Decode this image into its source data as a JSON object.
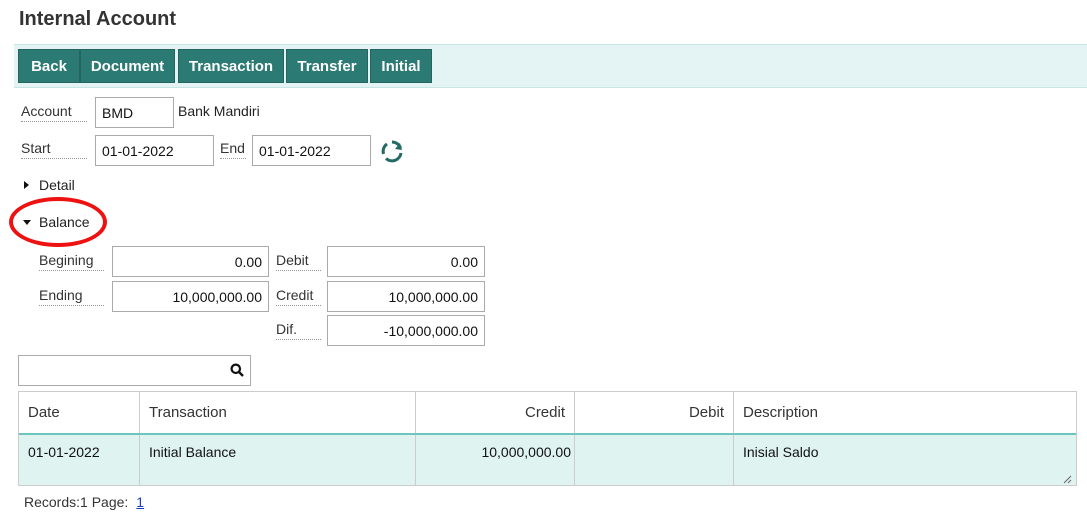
{
  "page": {
    "title": "Internal Account"
  },
  "toolbar": {
    "back": "Back",
    "document": "Document",
    "transaction": "Transaction",
    "transfer": "Transfer",
    "initial": "Initial"
  },
  "form": {
    "account_label": "Account",
    "account_code": "BMD",
    "account_name": "Bank Mandiri",
    "start_label": "Start",
    "start_value": "01-01-2022",
    "end_label": "End",
    "end_value": "01-01-2022",
    "refresh_icon": "refresh-icon"
  },
  "sections": {
    "detail": "Detail",
    "balance": "Balance"
  },
  "balance": {
    "beginning_label": "Begining",
    "beginning_value": "0.00",
    "ending_label": "Ending",
    "ending_value": "10,000,000.00",
    "debit_label": "Debit",
    "debit_value": "0.00",
    "credit_label": "Credit",
    "credit_value": "10,000,000.00",
    "dif_label": "Dif.",
    "dif_value": "-10,000,000.00"
  },
  "search": {
    "placeholder": "",
    "icon": "search-icon"
  },
  "table": {
    "columns": [
      "Date",
      "Transaction",
      "Credit",
      "Debit",
      "Description"
    ],
    "rows": [
      {
        "date": "01-01-2022",
        "transaction": "Initial Balance",
        "credit": "10,000,000.00",
        "debit": "",
        "description": "Inisial Saldo"
      }
    ]
  },
  "pager": {
    "records_text": "Records:1  Page:",
    "page": "1"
  },
  "colors": {
    "toolbar_button": "#2c7a74",
    "toolbar_bg": "#e4f4f4",
    "row_bg": "#dff3f1",
    "accent": "#6cc6bd",
    "annotation": "#ee1111"
  }
}
